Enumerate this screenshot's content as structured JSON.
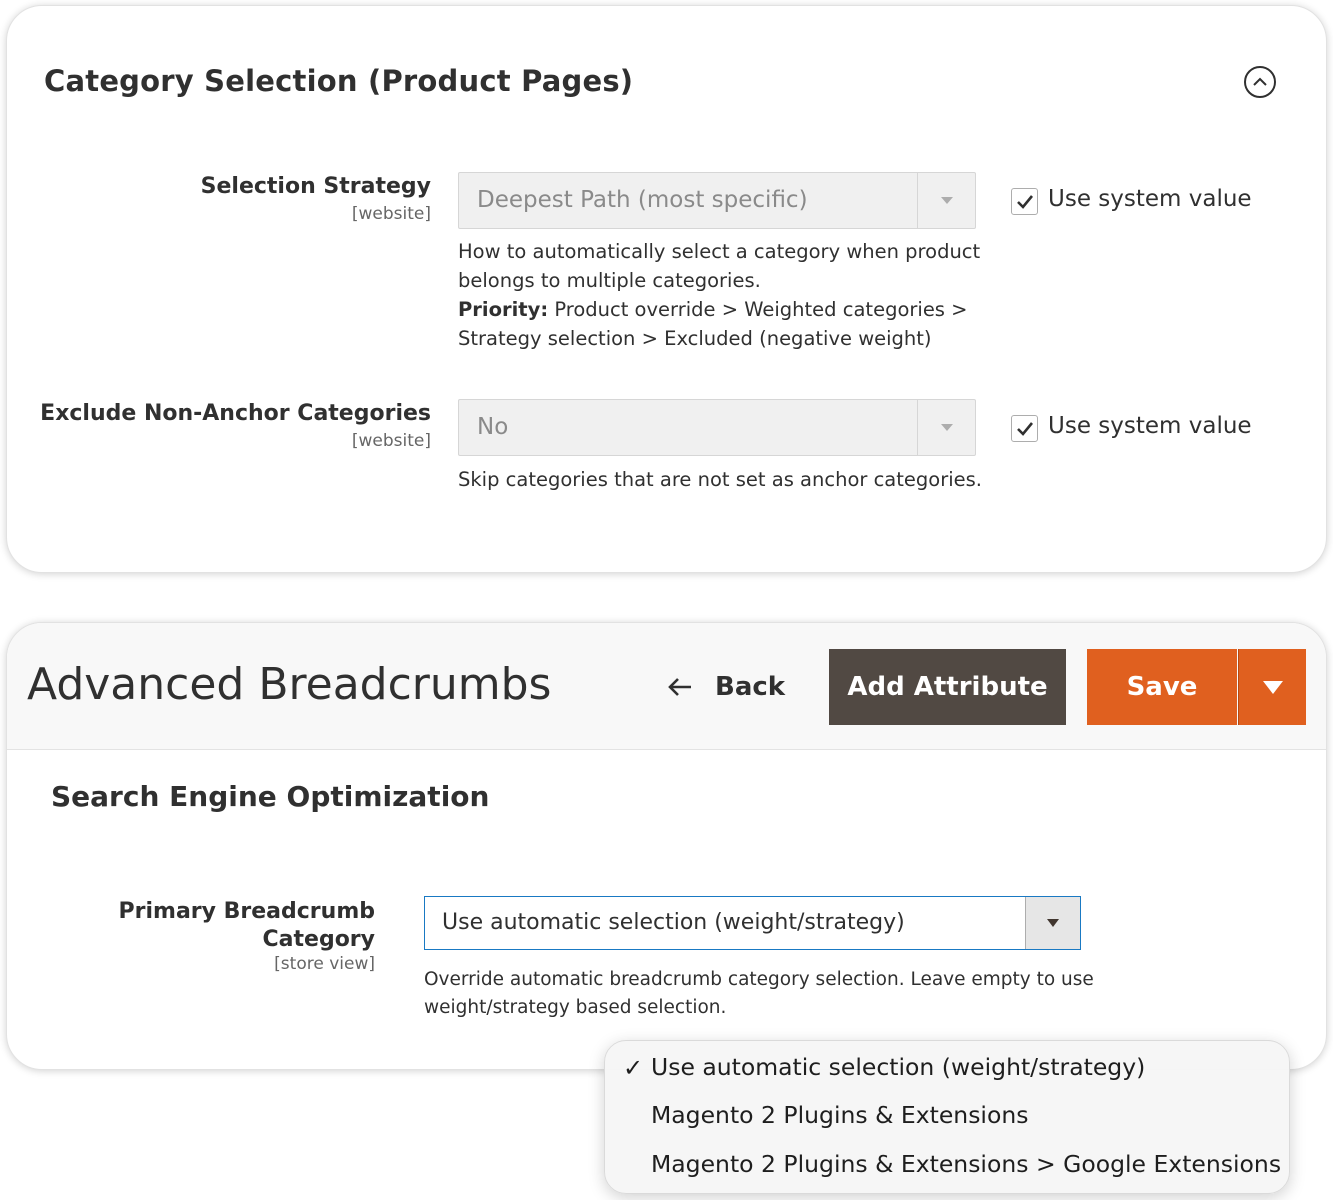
{
  "category_section": {
    "title": "Category Selection (Product Pages)",
    "fields": [
      {
        "label": "Selection Strategy",
        "scope": "[website]",
        "value": "Deepest Path (most specific)",
        "use_system_value_label": "Use system value",
        "use_system_value_checked": true,
        "note_line1": "How to automatically select a category when product",
        "note_line2": "belongs to multiple categories.",
        "note_priority_label": "Priority:",
        "note_priority_text": " Product override > Weighted categories >",
        "note_line4": "Strategy selection > Excluded (negative weight)"
      },
      {
        "label": "Exclude Non-Anchor Categories",
        "scope": "[website]",
        "value": "No",
        "use_system_value_label": "Use system value",
        "use_system_value_checked": true,
        "note_line1": "Skip categories that are not set as anchor categories."
      }
    ]
  },
  "page_header": {
    "title": "Advanced Breadcrumbs",
    "back_label": "Back",
    "add_attribute_label": "Add Attribute",
    "save_label": "Save"
  },
  "seo_section": {
    "title": "Search Engine Optimization",
    "primary_breadcrumb": {
      "label_line1": "Primary Breadcrumb",
      "label_line2": "Category",
      "scope": "[store view]",
      "value": "Use automatic selection (weight/strategy)",
      "note_line1": "Override automatic breadcrumb category selection. Leave empty to use",
      "note_line2": "weight/strategy based selection."
    }
  },
  "dropdown": {
    "options": [
      {
        "label": "Use automatic selection (weight/strategy)",
        "selected": true
      },
      {
        "label": "Magento 2 Plugins & Extensions",
        "selected": false
      },
      {
        "label": "Magento 2 Plugins & Extensions > Google Extensions",
        "selected": false
      }
    ],
    "check_glyph": "✓"
  },
  "colors": {
    "primary_button": "#e0601f",
    "secondary_button": "#514943",
    "focus_border": "#1979c3"
  }
}
